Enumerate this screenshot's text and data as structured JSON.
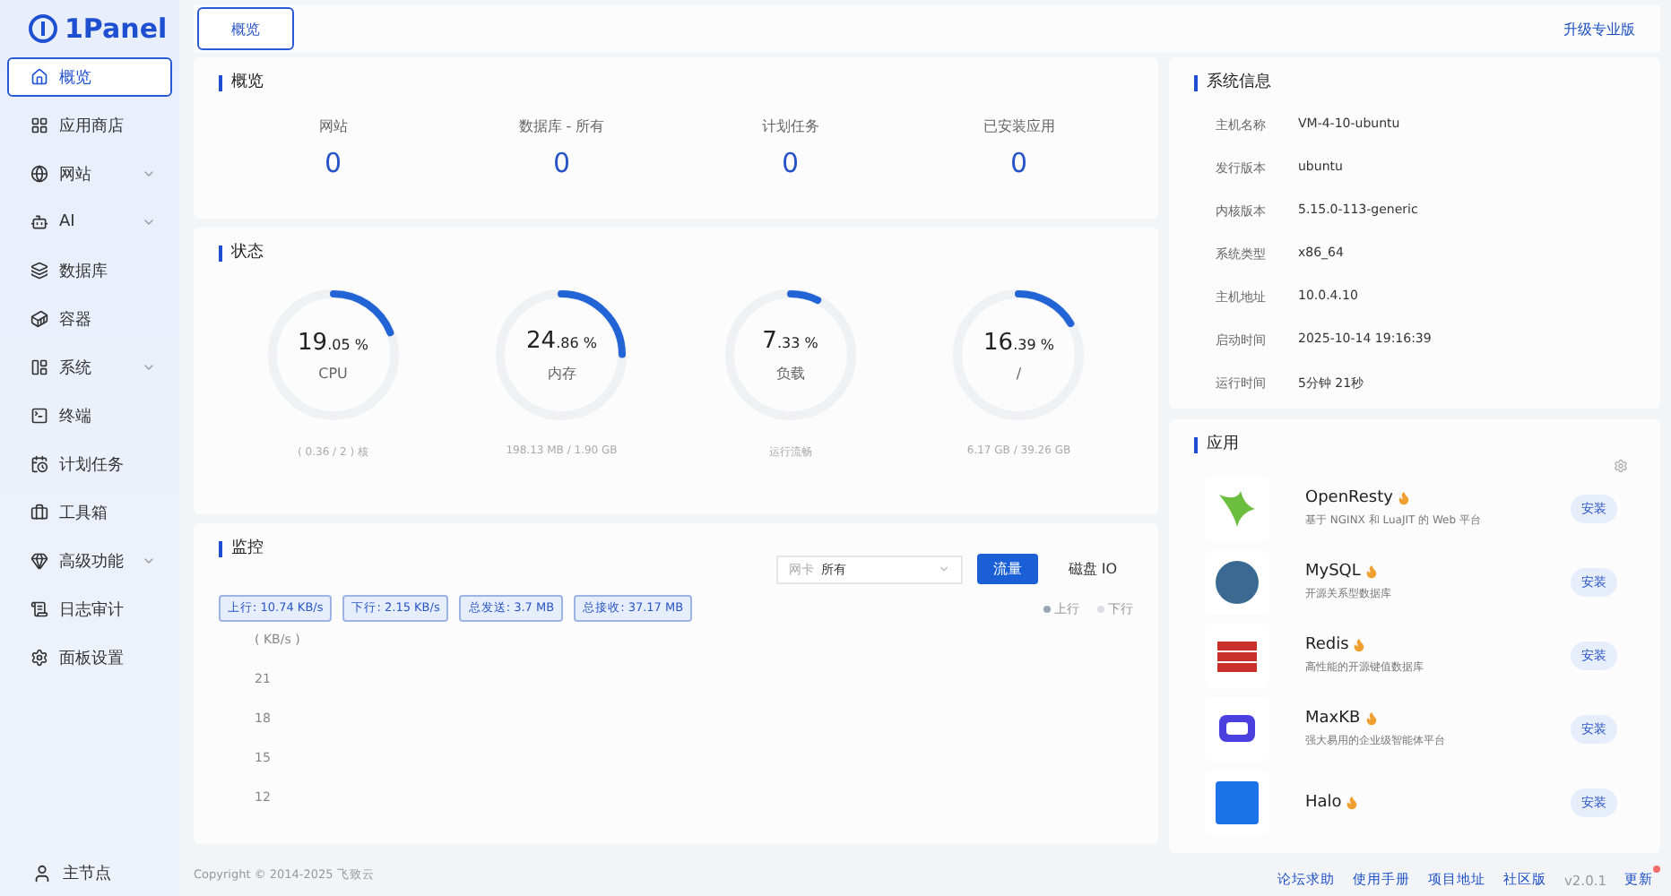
{
  "brand": {
    "name": "1Panel"
  },
  "sidebar": {
    "items": [
      {
        "label": "概览",
        "selected": true,
        "expandable": false
      },
      {
        "label": "应用商店",
        "selected": false,
        "expandable": false
      },
      {
        "label": "网站",
        "selected": false,
        "expandable": true
      },
      {
        "label": "AI",
        "selected": false,
        "expandable": true
      },
      {
        "label": "数据库",
        "selected": false,
        "expandable": false
      },
      {
        "label": "容器",
        "selected": false,
        "expandable": false
      },
      {
        "label": "系统",
        "selected": false,
        "expandable": true
      },
      {
        "label": "终端",
        "selected": false,
        "expandable": false
      },
      {
        "label": "计划任务",
        "selected": false,
        "expandable": false
      },
      {
        "label": "工具箱",
        "selected": false,
        "expandable": false
      },
      {
        "label": "高级功能",
        "selected": false,
        "expandable": true
      },
      {
        "label": "日志审计",
        "selected": false,
        "expandable": false
      },
      {
        "label": "面板设置",
        "selected": false,
        "expandable": false
      }
    ],
    "node": "主节点"
  },
  "tabs": [
    {
      "label": "概览",
      "selected": true
    }
  ],
  "upgrade_link": "升级专业版",
  "overview": {
    "title": "概览",
    "stats": [
      {
        "label": "网站",
        "value": "0"
      },
      {
        "label": "数据库 - 所有",
        "value": "0"
      },
      {
        "label": "计划任务",
        "value": "0"
      },
      {
        "label": "已安装应用",
        "value": "0"
      }
    ]
  },
  "status": {
    "title": "状态",
    "gauges": [
      {
        "value": "19.05 %",
        "label": "CPU",
        "level": 0.1905,
        "detail": "( 0.36 / 2 ) 核"
      },
      {
        "value": "24.86 %",
        "label": "内存",
        "level": 0.2486,
        "detail": "198.13 MB / 1.90 GB"
      },
      {
        "value": "7.33 %",
        "label": "负载",
        "level": 0.0733,
        "detail": "运行流畅"
      },
      {
        "value": "16.39 %",
        "label": "/",
        "level": 0.1639,
        "detail": "6.17 GB / 39.26 GB"
      }
    ]
  },
  "monitor": {
    "title": "监控",
    "select": {
      "label": "网卡",
      "value": "所有"
    },
    "modes": [
      {
        "label": "流量",
        "selected": true
      },
      {
        "label": "磁盘 IO",
        "selected": false
      }
    ],
    "tags": [
      "上行: 10.74 KB/s",
      "下行: 2.15 KB/s",
      "总发送: 3.7 MB",
      "总接收: 37.17 MB"
    ],
    "legend": [
      {
        "label": "上行",
        "color": "#9aa3b5"
      },
      {
        "label": "下行",
        "color": "#dcdfe6"
      }
    ],
    "unit": "( KB/s )",
    "y_ticks": [
      "21",
      "18",
      "15",
      "12"
    ]
  },
  "copyright": "Copyright © 2014-2025 飞致云",
  "system_info": {
    "title": "系统信息",
    "rows": [
      {
        "label": "主机名称",
        "value": "VM-4-10-ubuntu"
      },
      {
        "label": "发行版本",
        "value": "ubuntu"
      },
      {
        "label": "内核版本",
        "value": "5.15.0-113-generic"
      },
      {
        "label": "系统类型",
        "value": "x86_64"
      },
      {
        "label": "主机地址",
        "value": "10.0.4.10"
      },
      {
        "label": "启动时间",
        "value": "2025-10-14 19:16:39"
      },
      {
        "label": "运行时间",
        "value": "5分钟 21秒"
      }
    ]
  },
  "apps": {
    "title": "应用",
    "items": [
      {
        "name": "OpenResty",
        "hot": true,
        "description": "基于 NGINX 和 LuaJIT 的 Web 平台",
        "action": "安装"
      },
      {
        "name": "MySQL",
        "hot": true,
        "description": "开源关系型数据库",
        "action": "安装"
      },
      {
        "name": "Redis",
        "hot": true,
        "description": "高性能的开源键值数据库",
        "action": "安装"
      },
      {
        "name": "MaxKB",
        "hot": true,
        "description": "强大易用的企业级智能体平台",
        "action": "安装"
      },
      {
        "name": "Halo",
        "hot": true,
        "action": "安装"
      }
    ]
  },
  "footer": {
    "links": [
      "论坛求助",
      "使用手册",
      "项目地址"
    ],
    "edition": "社区版",
    "version": "v2.0.1",
    "update": "更新",
    "update_available": true
  }
}
